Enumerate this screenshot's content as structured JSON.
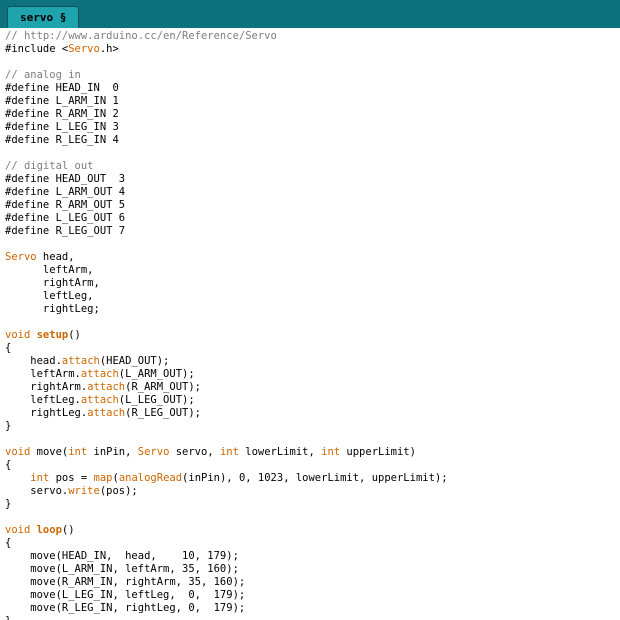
{
  "window": {
    "tab_label": "servo §"
  },
  "colors": {
    "header_bg": "#0d727b",
    "tab_bg": "#1fa3ac",
    "tab_border": "#0a555c",
    "code_bg": "#ffffff",
    "plain": "#000000",
    "comment": "#7e7e7e",
    "keyword": "#cc6600"
  },
  "code": {
    "lines": [
      [
        {
          "t": "// http://www.arduino.cc/en/Reference/Servo",
          "c": "comment"
        }
      ],
      [
        {
          "t": "#include <",
          "c": "plain"
        },
        {
          "t": "Servo",
          "c": "keyword"
        },
        {
          "t": ".h>",
          "c": "plain"
        }
      ],
      [],
      [
        {
          "t": "// analog in",
          "c": "comment"
        }
      ],
      [
        {
          "t": "#define HEAD_IN  0",
          "c": "plain"
        }
      ],
      [
        {
          "t": "#define L_ARM_IN 1",
          "c": "plain"
        }
      ],
      [
        {
          "t": "#define R_ARM_IN 2",
          "c": "plain"
        }
      ],
      [
        {
          "t": "#define L_LEG_IN 3",
          "c": "plain"
        }
      ],
      [
        {
          "t": "#define R_LEG_IN 4",
          "c": "plain"
        }
      ],
      [],
      [
        {
          "t": "// digital out",
          "c": "comment"
        }
      ],
      [
        {
          "t": "#define HEAD_OUT  3",
          "c": "plain"
        }
      ],
      [
        {
          "t": "#define L_ARM_OUT 4",
          "c": "plain"
        }
      ],
      [
        {
          "t": "#define R_ARM_OUT 5",
          "c": "plain"
        }
      ],
      [
        {
          "t": "#define L_LEG_OUT 6",
          "c": "plain"
        }
      ],
      [
        {
          "t": "#define R_LEG_OUT 7",
          "c": "plain"
        }
      ],
      [],
      [
        {
          "t": "Servo",
          "c": "keyword"
        },
        {
          "t": " head,",
          "c": "plain"
        }
      ],
      [
        {
          "t": "      leftArm,",
          "c": "plain"
        }
      ],
      [
        {
          "t": "      rightArm,",
          "c": "plain"
        }
      ],
      [
        {
          "t": "      leftLeg,",
          "c": "plain"
        }
      ],
      [
        {
          "t": "      rightLeg;",
          "c": "plain"
        }
      ],
      [],
      [
        {
          "t": "void ",
          "c": "keyword"
        },
        {
          "t": "setup",
          "c": "kwbold"
        },
        {
          "t": "()",
          "c": "plain"
        }
      ],
      [
        {
          "t": "{",
          "c": "plain"
        }
      ],
      [
        {
          "t": "    head.",
          "c": "plain"
        },
        {
          "t": "attach",
          "c": "keyword"
        },
        {
          "t": "(HEAD_OUT);",
          "c": "plain"
        }
      ],
      [
        {
          "t": "    leftArm.",
          "c": "plain"
        },
        {
          "t": "attach",
          "c": "keyword"
        },
        {
          "t": "(L_ARM_OUT);",
          "c": "plain"
        }
      ],
      [
        {
          "t": "    rightArm.",
          "c": "plain"
        },
        {
          "t": "attach",
          "c": "keyword"
        },
        {
          "t": "(R_ARM_OUT);",
          "c": "plain"
        }
      ],
      [
        {
          "t": "    leftLeg.",
          "c": "plain"
        },
        {
          "t": "attach",
          "c": "keyword"
        },
        {
          "t": "(L_LEG_OUT);",
          "c": "plain"
        }
      ],
      [
        {
          "t": "    rightLeg.",
          "c": "plain"
        },
        {
          "t": "attach",
          "c": "keyword"
        },
        {
          "t": "(R_LEG_OUT);",
          "c": "plain"
        }
      ],
      [
        {
          "t": "}",
          "c": "plain"
        }
      ],
      [],
      [
        {
          "t": "void",
          "c": "keyword"
        },
        {
          "t": " move(",
          "c": "plain"
        },
        {
          "t": "int",
          "c": "keyword"
        },
        {
          "t": " inPin, ",
          "c": "plain"
        },
        {
          "t": "Servo",
          "c": "keyword"
        },
        {
          "t": " servo, ",
          "c": "plain"
        },
        {
          "t": "int",
          "c": "keyword"
        },
        {
          "t": " lowerLimit, ",
          "c": "plain"
        },
        {
          "t": "int",
          "c": "keyword"
        },
        {
          "t": " upperLimit)",
          "c": "plain"
        }
      ],
      [
        {
          "t": "{",
          "c": "plain"
        }
      ],
      [
        {
          "t": "    ",
          "c": "plain"
        },
        {
          "t": "int",
          "c": "keyword"
        },
        {
          "t": " pos = ",
          "c": "plain"
        },
        {
          "t": "map",
          "c": "keyword"
        },
        {
          "t": "(",
          "c": "plain"
        },
        {
          "t": "analogRead",
          "c": "keyword"
        },
        {
          "t": "(inPin), 0, 1023, lowerLimit, upperLimit);",
          "c": "plain"
        }
      ],
      [
        {
          "t": "    servo.",
          "c": "plain"
        },
        {
          "t": "write",
          "c": "keyword"
        },
        {
          "t": "(pos);",
          "c": "plain"
        }
      ],
      [
        {
          "t": "}",
          "c": "plain"
        }
      ],
      [],
      [
        {
          "t": "void ",
          "c": "keyword"
        },
        {
          "t": "loop",
          "c": "kwbold"
        },
        {
          "t": "()",
          "c": "plain"
        }
      ],
      [
        {
          "t": "{",
          "c": "plain"
        }
      ],
      [
        {
          "t": "    move(HEAD_IN,  head,    10, 179);",
          "c": "plain"
        }
      ],
      [
        {
          "t": "    move(L_ARM_IN, leftArm, 35, 160);",
          "c": "plain"
        }
      ],
      [
        {
          "t": "    move(R_ARM_IN, rightArm, 35, 160);",
          "c": "plain"
        }
      ],
      [
        {
          "t": "    move(L_LEG_IN, leftLeg,  0,  179);",
          "c": "plain"
        }
      ],
      [
        {
          "t": "    move(R_LEG_IN, rightLeg, 0,  179);",
          "c": "plain"
        }
      ],
      [
        {
          "t": "}",
          "c": "plain"
        }
      ]
    ]
  }
}
